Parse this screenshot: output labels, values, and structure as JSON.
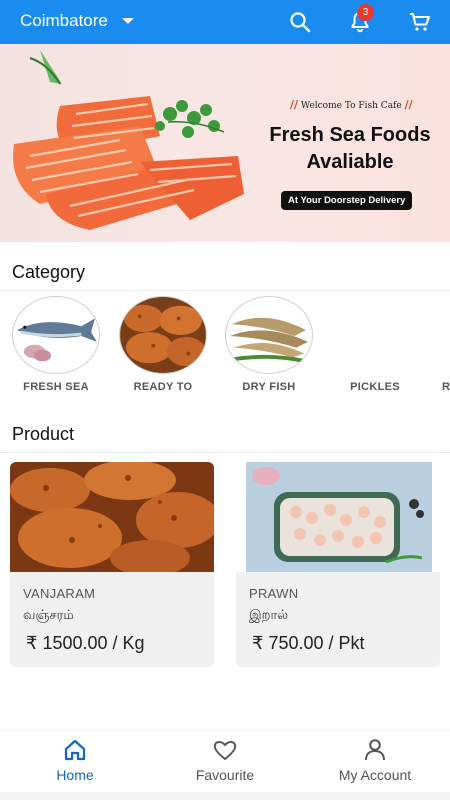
{
  "topbar": {
    "city": "Coimbatore",
    "icons": [
      "chevron-down-icon",
      "search-icon",
      "bell-icon",
      "cart-icon"
    ],
    "notification_count": "3",
    "color": "#1a8cf0"
  },
  "banner": {
    "welcome": "Welcome To Fish Cafe",
    "welcome_mark": "//",
    "title_line1": "Fresh Sea Foods",
    "title_line2": "Avaliable",
    "badge": "At Your Doorstep Delivery"
  },
  "category": {
    "title": "Category",
    "items": [
      {
        "label": "FRESH SEA"
      },
      {
        "label": "READY TO"
      },
      {
        "label": "DRY FISH"
      },
      {
        "label": "PICKLES"
      },
      {
        "label": "RE"
      }
    ]
  },
  "product": {
    "title": "Product",
    "items": [
      {
        "name": "VANJARAM",
        "name_tamil": "வஞ்சரம்",
        "price": "₹ 1500.00 / Kg"
      },
      {
        "name": "PRAWN",
        "name_tamil": "இறால்",
        "price": "₹ 750.00 / Pkt"
      }
    ]
  },
  "bottom_nav": {
    "items": [
      {
        "label": "Home",
        "icon": "home-icon",
        "active": true
      },
      {
        "label": "Favourite",
        "icon": "heart-icon",
        "active": false
      },
      {
        "label": "My Account",
        "icon": "person-icon",
        "active": false
      }
    ],
    "active_color": "#1565c0"
  }
}
